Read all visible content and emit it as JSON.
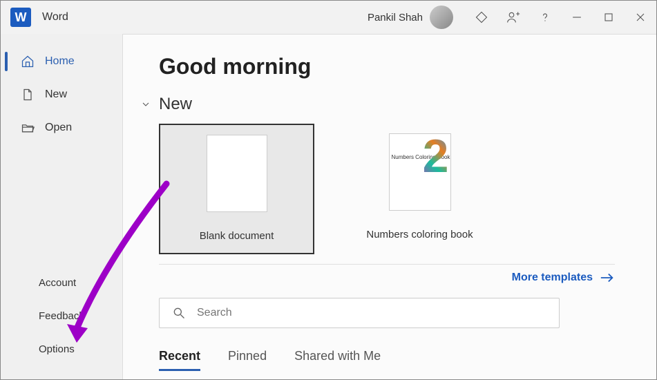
{
  "titlebar": {
    "app_name": "Word",
    "user_name": "Pankil Shah"
  },
  "sidebar": {
    "items": [
      {
        "label": "Home",
        "icon": "home-icon",
        "active": true
      },
      {
        "label": "New",
        "icon": "document-icon",
        "active": false
      },
      {
        "label": "Open",
        "icon": "folder-icon",
        "active": false
      }
    ],
    "bottom_items": [
      {
        "label": "Account"
      },
      {
        "label": "Feedback"
      },
      {
        "label": "Options"
      }
    ]
  },
  "content": {
    "greeting": "Good morning",
    "new_section_title": "New",
    "templates": [
      {
        "label": "Blank document",
        "selected": true
      },
      {
        "label": "Numbers coloring book",
        "selected": false,
        "thumb_label": "Numbers Coloring Book"
      }
    ],
    "more_templates_label": "More templates",
    "search": {
      "placeholder": "Search",
      "value": ""
    },
    "tabs": [
      {
        "label": "Recent",
        "active": true
      },
      {
        "label": "Pinned",
        "active": false
      },
      {
        "label": "Shared with Me",
        "active": false
      }
    ]
  },
  "annotation": {
    "target": "Options"
  }
}
